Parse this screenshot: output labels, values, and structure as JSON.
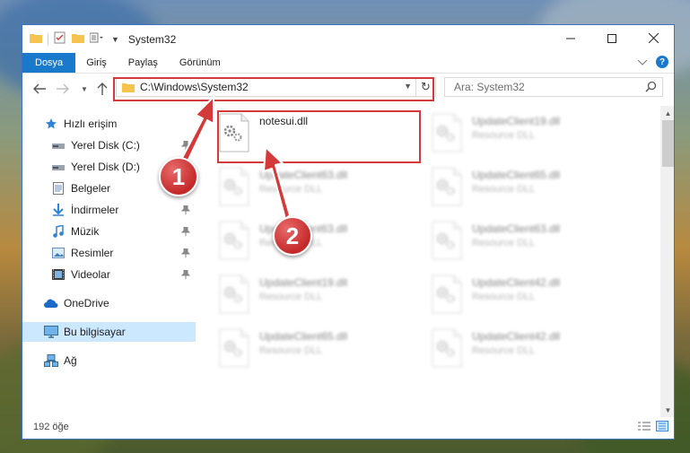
{
  "window": {
    "title": "System32"
  },
  "ribbon": {
    "tabs": [
      "Dosya",
      "Giriş",
      "Paylaş",
      "Görünüm"
    ]
  },
  "address": {
    "path": "C:\\Windows\\System32"
  },
  "search": {
    "placeholder": "Ara: System32"
  },
  "sidebar": {
    "items": [
      {
        "label": "Hızlı erişim",
        "icon": "star-icon"
      },
      {
        "label": "Yerel Disk (C:)",
        "icon": "drive-icon"
      },
      {
        "label": "Yerel Disk (D:)",
        "icon": "drive-icon"
      },
      {
        "label": "Belgeler",
        "icon": "documents-icon"
      },
      {
        "label": "İndirmeler",
        "icon": "download-icon"
      },
      {
        "label": "Müzik",
        "icon": "music-icon"
      },
      {
        "label": "Resimler",
        "icon": "pictures-icon"
      },
      {
        "label": "Videolar",
        "icon": "videos-icon"
      },
      {
        "label": "OneDrive",
        "icon": "cloud-icon"
      },
      {
        "label": "Bu bilgisayar",
        "icon": "computer-icon"
      },
      {
        "label": "Ağ",
        "icon": "network-icon"
      }
    ]
  },
  "files": [
    {
      "name": "notesui.dll",
      "type": ""
    },
    {
      "name": "UpdateClient19.dll",
      "type": "Resource DLL"
    },
    {
      "name": "UpdateClient63.dll",
      "type": "Resource DLL"
    },
    {
      "name": "UpdateClient65.dll",
      "type": "Resource DLL"
    },
    {
      "name": "UpdateClient63.dll",
      "type": "Resource DLL"
    },
    {
      "name": "UpdateClient63.dll",
      "type": "Resource DLL"
    },
    {
      "name": "UpdateClient19.dll",
      "type": "Resource DLL"
    },
    {
      "name": "UpdateClient42.dll",
      "type": "Resource DLL"
    },
    {
      "name": "UpdateClient65.dll",
      "type": "Resource DLL"
    },
    {
      "name": "UpdateClient42.dll",
      "type": "Resource DLL"
    }
  ],
  "status": {
    "item_count": "192 öğe"
  },
  "callouts": [
    "1",
    "2"
  ],
  "colors": {
    "accent": "#1979ca",
    "annotation": "#d53a3a",
    "selected": "#cce8ff"
  }
}
